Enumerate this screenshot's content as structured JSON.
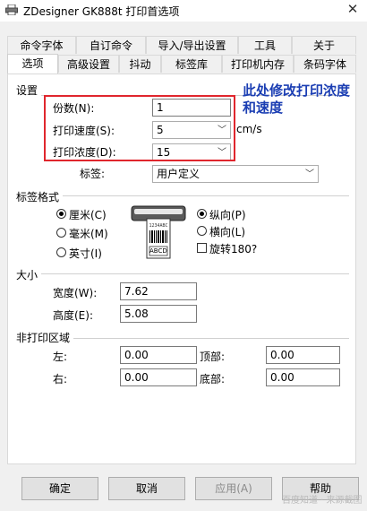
{
  "window": {
    "title": "ZDesigner GK888t 打印首选项",
    "close_glyph": "✕"
  },
  "tabs_row1": [
    "命令字体",
    "自订命令",
    "导入/导出设置",
    "工具",
    "关于"
  ],
  "tabs_row2": [
    "选项",
    "高级设置",
    "抖动",
    "标签库",
    "打印机内存",
    "条码字体"
  ],
  "active_tab": "选项",
  "settings": {
    "title": "设置",
    "copies_label": "份数(N):",
    "copies_value": "1",
    "speed_label": "打印速度(S):",
    "speed_value": "5",
    "speed_unit": "cm/s",
    "darkness_label": "打印浓度(D):",
    "darkness_value": "15",
    "stock_label": "标签:",
    "stock_value": "用户定义"
  },
  "annotation": {
    "line1": "此处修改打印浓度",
    "line2": "和速度",
    "color": "#1b3eb3"
  },
  "label_format": {
    "title": "标签格式",
    "units": [
      "厘米(C)",
      "毫米(M)",
      "英寸(I)"
    ],
    "units_selected": "厘米(C)",
    "orientation": [
      "纵向(P)",
      "横向(L)"
    ],
    "orientation_selected": "纵向(P)",
    "rotate_label": "旋转180?",
    "rotate_checked": false,
    "preview_text": "ABCD"
  },
  "size": {
    "title": "大小",
    "width_label": "宽度(W):",
    "width_value": "7.62",
    "height_label": "高度(E):",
    "height_value": "5.08"
  },
  "unprintable": {
    "title": "非打印区域",
    "left_label": "左:",
    "left_value": "0.00",
    "top_label": "顶部:",
    "top_value": "0.00",
    "right_label": "右:",
    "right_value": "0.00",
    "bottom_label": "底部:",
    "bottom_value": "0.00"
  },
  "buttons": {
    "ok": "确定",
    "cancel": "取消",
    "apply": "应用(A)",
    "help": "帮助"
  },
  "watermark": "百度知道 · 来源截图",
  "colors": {
    "highlight": "#e0262d",
    "dialog_bg": "#f0f0f0"
  }
}
